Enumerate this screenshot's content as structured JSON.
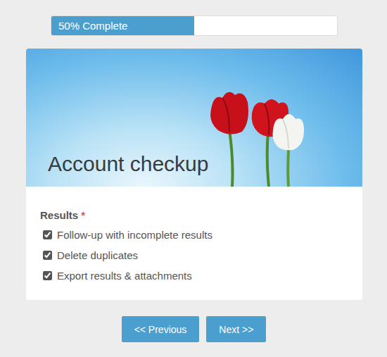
{
  "progress": {
    "label": "50% Complete",
    "level": 0.5
  },
  "card": {
    "title": "Account checkup"
  },
  "question": {
    "label": "Results",
    "required_mark": "*",
    "options": [
      {
        "label": "Follow-up with incomplete results",
        "checked": true
      },
      {
        "label": "Delete duplicates",
        "checked": true
      },
      {
        "label": "Export results & attachments",
        "checked": true
      }
    ]
  },
  "buttons": [
    {
      "label": "<< Previous"
    },
    {
      "label": "Next >>"
    }
  ]
}
